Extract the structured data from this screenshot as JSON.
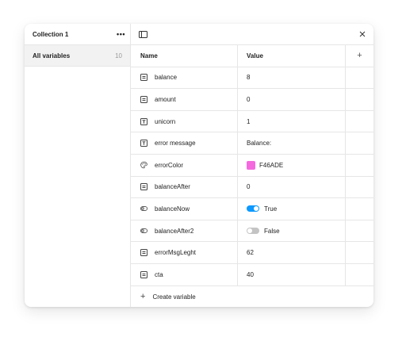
{
  "sidebar": {
    "collection_title": "Collection 1",
    "more_label": "•••",
    "items": [
      {
        "label": "All variables",
        "count": "10"
      }
    ]
  },
  "table": {
    "headers": {
      "name": "Name",
      "value": "Value",
      "add": "+"
    },
    "rows": [
      {
        "name": "balance",
        "type": "number",
        "value": "8"
      },
      {
        "name": "amount",
        "type": "number",
        "value": "0"
      },
      {
        "name": "unicorn",
        "type": "string",
        "value": "1"
      },
      {
        "name": "error message",
        "type": "string",
        "value": "Balance:"
      },
      {
        "name": "errorColor",
        "type": "color",
        "value": "F46ADE",
        "swatch": "#F46ADE"
      },
      {
        "name": "balanceAfter",
        "type": "number",
        "value": "0"
      },
      {
        "name": "balanceNow",
        "type": "boolean",
        "value": "True"
      },
      {
        "name": "balanceAfter2",
        "type": "boolean",
        "value": "False"
      },
      {
        "name": "errorMsgLeght",
        "type": "number",
        "value": "62"
      },
      {
        "name": "cta",
        "type": "number",
        "value": "40"
      }
    ],
    "create_label": "Create variable"
  },
  "colors": {
    "accent": "#0d99ff",
    "toggle_off": "#c4c4c4",
    "border": "#e6e6e6",
    "selected_bg": "#f2f2f2"
  }
}
